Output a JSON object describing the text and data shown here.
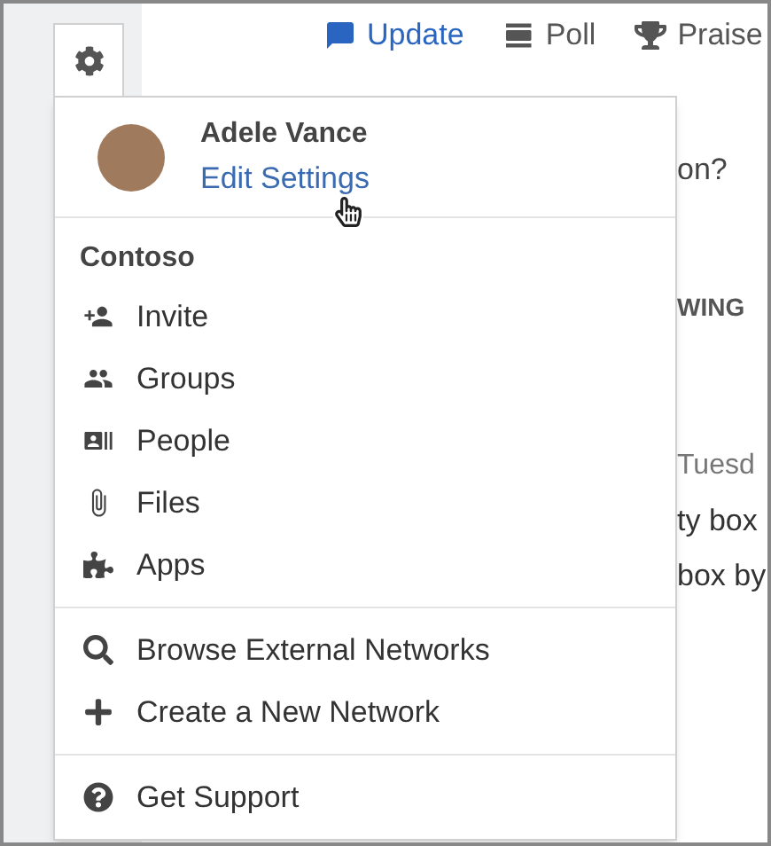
{
  "toolbar": [
    {
      "label": "Update",
      "kind": "update",
      "selected": true
    },
    {
      "label": "Poll",
      "kind": "poll",
      "selected": false
    },
    {
      "label": "Praise",
      "kind": "praise",
      "selected": false
    }
  ],
  "feed_fragments": [
    {
      "text": "on?",
      "kind": "question"
    },
    {
      "text": "WING",
      "kind": "tab"
    },
    {
      "text": "Tuesd",
      "kind": "meta"
    },
    {
      "text": "ty box",
      "kind": "body"
    },
    {
      "text": "box by",
      "kind": "body"
    }
  ],
  "menu": {
    "user": {
      "name": "Adele Vance",
      "link": "Edit Settings"
    },
    "network": {
      "title": "Contoso",
      "items": [
        {
          "label": "Invite",
          "kind": "invite"
        },
        {
          "label": "Groups",
          "kind": "groups"
        },
        {
          "label": "People",
          "kind": "people"
        },
        {
          "label": "Files",
          "kind": "files"
        },
        {
          "label": "Apps",
          "kind": "apps"
        }
      ]
    },
    "actions": [
      {
        "label": "Browse External Networks",
        "kind": "search"
      },
      {
        "label": "Create a New Network",
        "kind": "add"
      }
    ],
    "support": [
      {
        "label": "Get Support",
        "kind": "help"
      }
    ]
  }
}
